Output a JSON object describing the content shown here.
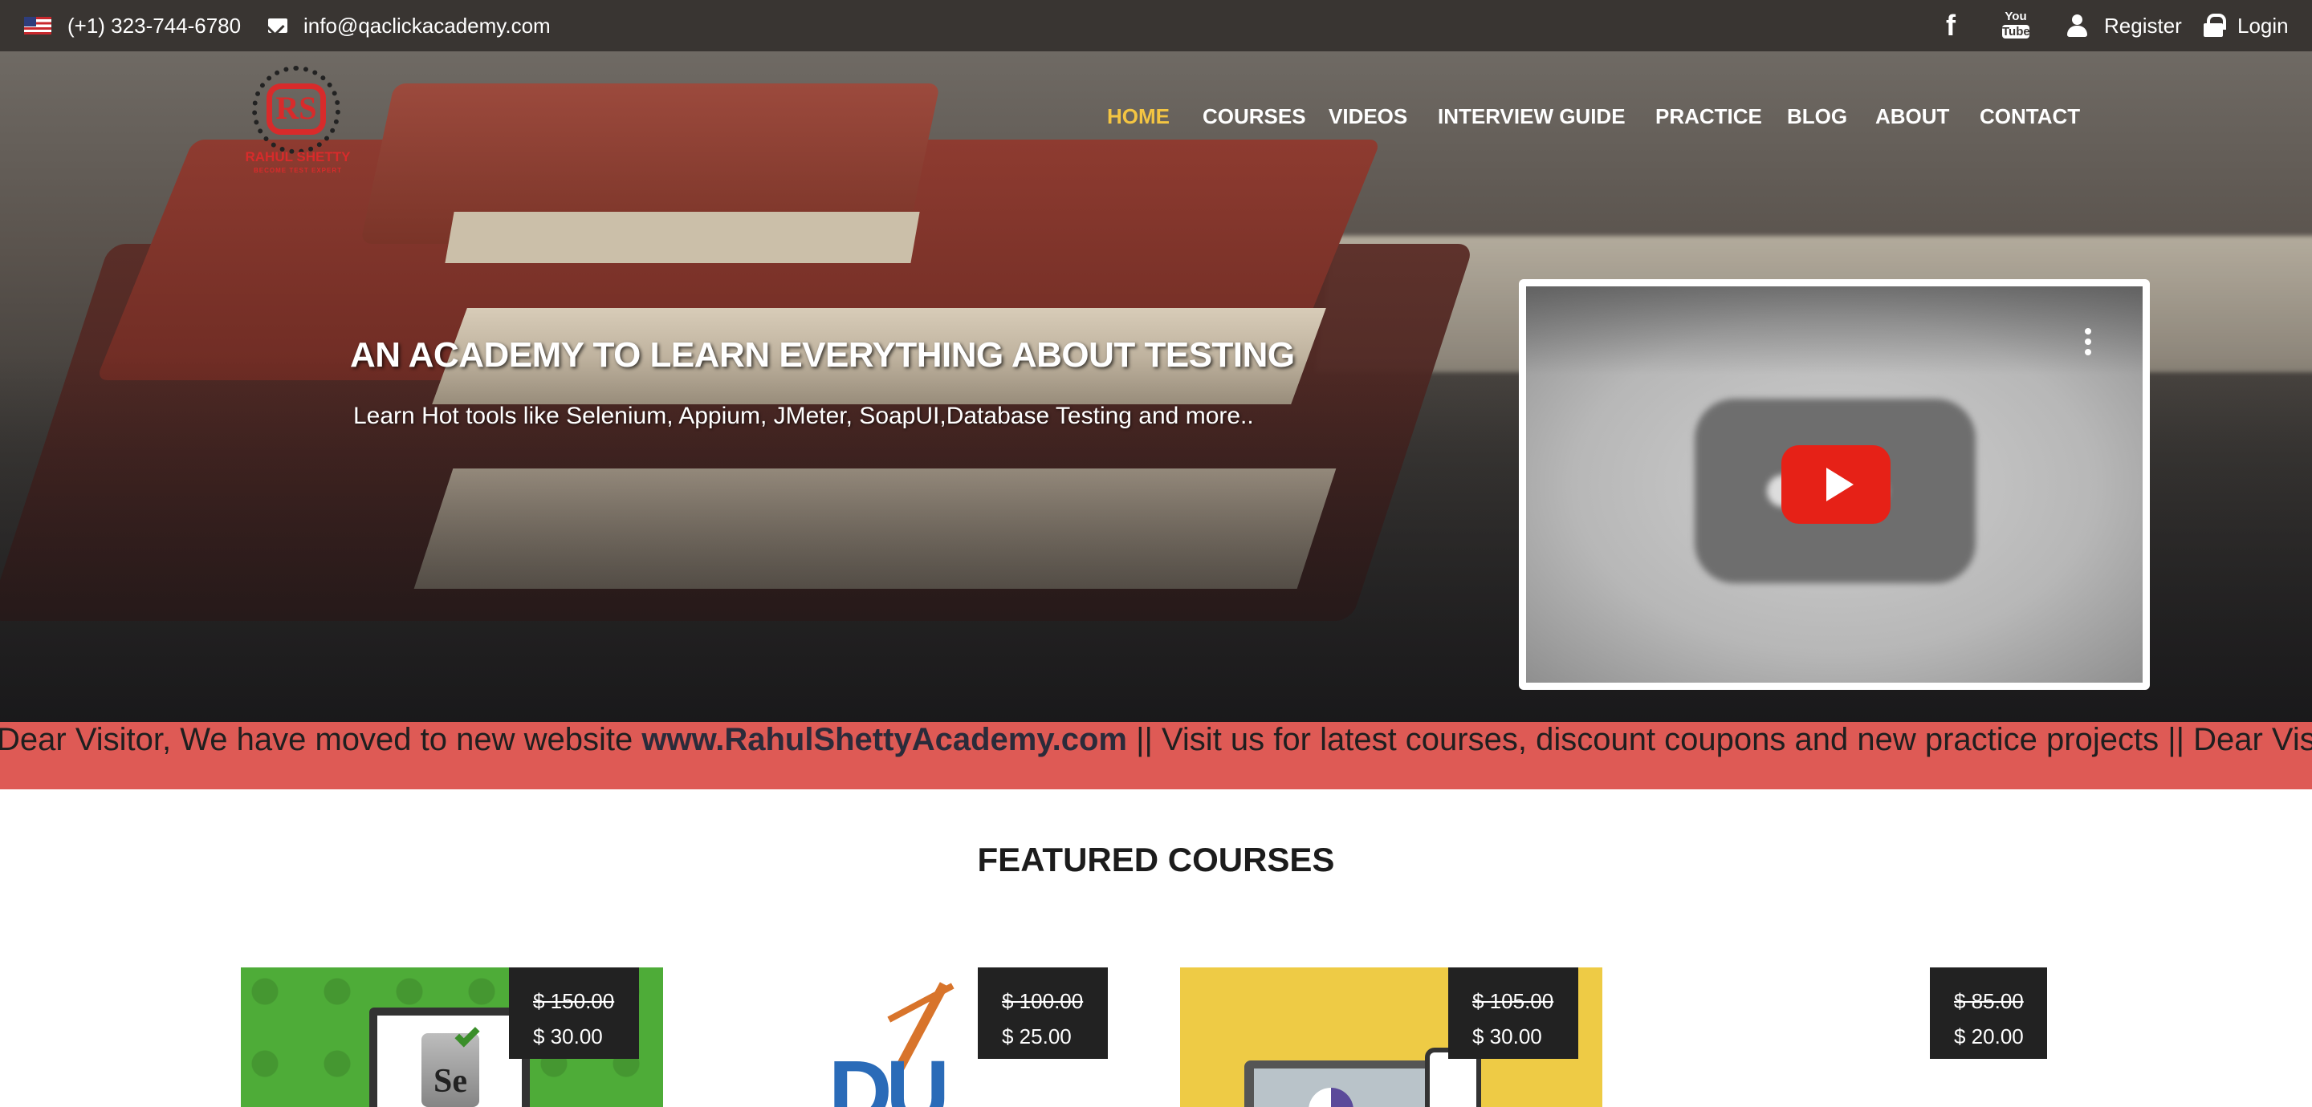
{
  "topbar": {
    "phone": "(+1) 323-744-6780",
    "email": "info@qaclickacademy.com",
    "register_label": "Register",
    "login_label": "Login",
    "youtube_icon_text": "You",
    "youtube_icon_text2": "Tube",
    "facebook_icon_text": "f"
  },
  "logo": {
    "mark": "RS",
    "text": "RAHUL SHETTY",
    "sub": "ACADEMY",
    "tagline": "BECOME TEST EXPERT"
  },
  "nav": {
    "items": [
      "HOME",
      "COURSES",
      "VIDEOS",
      "INTERVIEW GUIDE",
      "PRACTICE",
      "BLOG",
      "ABOUT",
      "CONTACT"
    ],
    "active": "HOME",
    "active_color": "#f4c542"
  },
  "hero": {
    "title": "AN ACADEMY TO LEARN EVERYTHING ABOUT TESTING",
    "subtitle": "Learn Hot tools like Selenium, Appium, JMeter, SoapUI,Database Testing and more.."
  },
  "ticker": {
    "prefix": "Dear Visitor, We have moved to new website ",
    "link": "www.RahulShettyAcademy.com",
    "suffix": " || Visit us for latest courses, discount coupons and new practice projects || Dear Visitor, W",
    "background": "#de5a55"
  },
  "featured": {
    "heading": "FEATURED COURSES",
    "courses": [
      {
        "old_price": "$ 150.00",
        "price": "$ 30.00",
        "icon": "selenium-icon"
      },
      {
        "old_price": "$ 100.00",
        "price": "$ 25.00",
        "icon": "crane-icon"
      },
      {
        "old_price": "$ 105.00",
        "price": "$ 30.00",
        "icon": "laptop-chart-icon"
      },
      {
        "old_price": "$ 85.00",
        "price": "$ 20.00",
        "icon": ""
      }
    ],
    "card_text": {
      "selenium": "Se",
      "blocks": "DU"
    }
  },
  "colors": {
    "topbar": "#393532",
    "price_tag": "#222222",
    "play_button": "#e62117"
  }
}
